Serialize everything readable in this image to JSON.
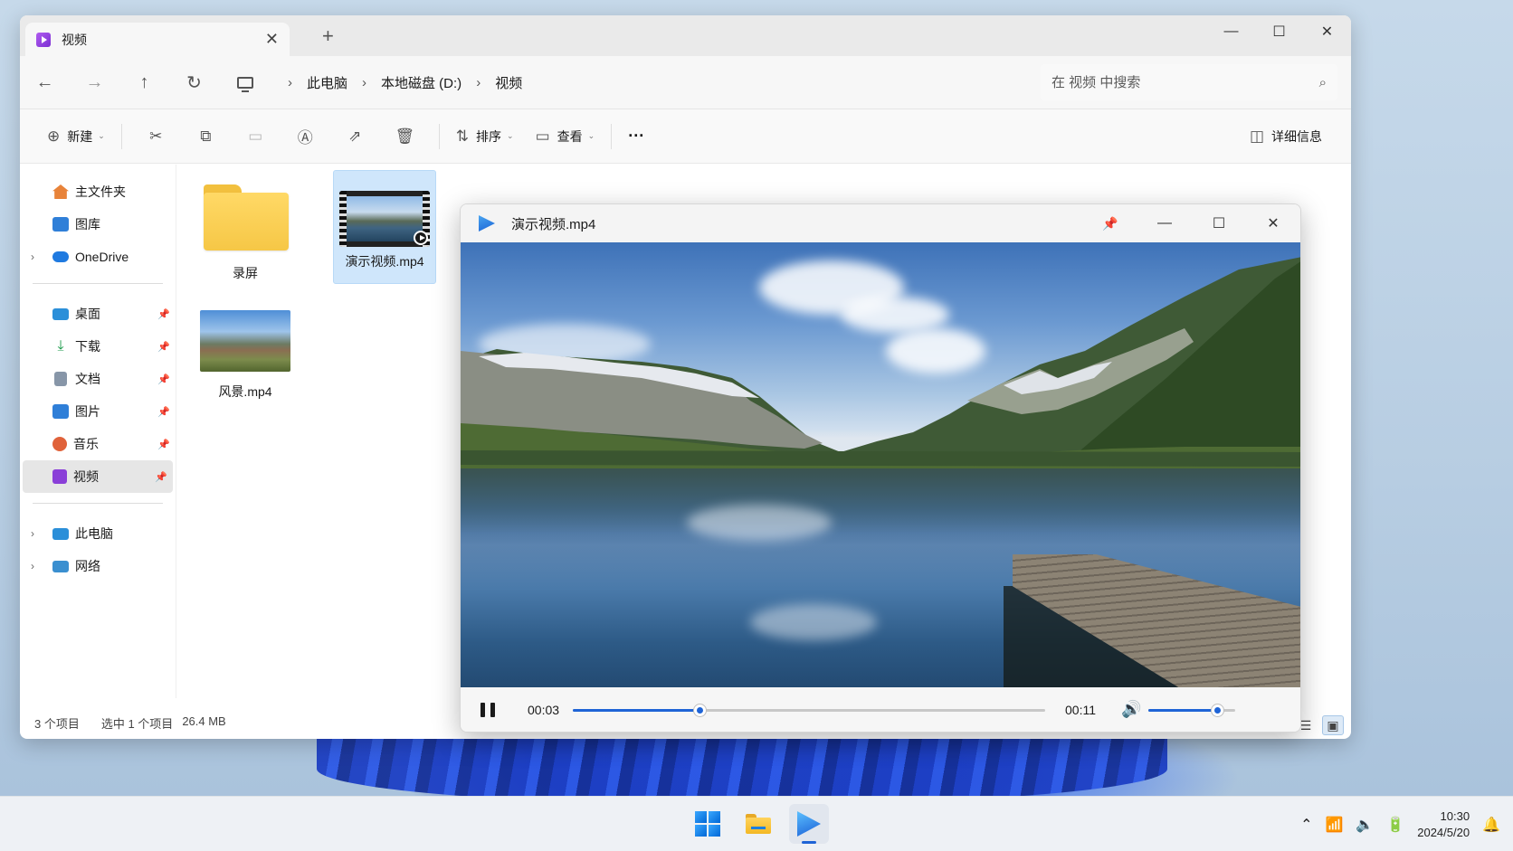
{
  "explorer": {
    "tab_title": "视频",
    "tab_close": "✕",
    "new_tab": "+",
    "window_controls": [
      "—",
      "☐",
      "✕"
    ],
    "nav": {
      "back": "←",
      "forward": "→",
      "up": "↑",
      "refresh": "↻"
    },
    "breadcrumb": [
      "此电脑",
      "本地磁盘 (D:)",
      "视频"
    ],
    "breadcrumb_sep": "›",
    "search_placeholder": "在 视频 中搜索",
    "commands": {
      "new_label": "新建",
      "sort_label": "排序",
      "view_label": "查看",
      "more": "···",
      "details_label": "详细信息"
    },
    "sidebar": {
      "top": [
        {
          "label": "主文件夹",
          "icon": "home-icon",
          "color": "#e8833a"
        },
        {
          "label": "图库",
          "icon": "gallery-icon",
          "color": "#2f7fd8"
        },
        {
          "label": "OneDrive",
          "icon": "cloud-icon",
          "color": "#1f7ae0"
        }
      ],
      "quick": [
        {
          "label": "桌面",
          "icon": "desktop-icon",
          "color": "#2b8fd9"
        },
        {
          "label": "下载",
          "icon": "download-icon",
          "color": "#1a9a4a"
        },
        {
          "label": "文档",
          "icon": "document-icon",
          "color": "#8796a8"
        },
        {
          "label": "图片",
          "icon": "pictures-icon",
          "color": "#2f7fd8"
        },
        {
          "label": "音乐",
          "icon": "music-icon",
          "color": "#e0623a"
        },
        {
          "label": "视频",
          "icon": "video-icon",
          "color": "#8a3fd8"
        }
      ],
      "bottom": [
        {
          "label": "此电脑",
          "icon": "pc-icon",
          "color": "#2b8fd9"
        },
        {
          "label": "网络",
          "icon": "network-icon",
          "color": "#3a8fd0"
        }
      ]
    },
    "files": [
      {
        "name": "录屏",
        "type": "folder"
      },
      {
        "name": "演示视频.mp4",
        "type": "video",
        "selected": true
      },
      {
        "name": "风景.mp4",
        "type": "video"
      }
    ],
    "status": {
      "count": "3 个项目",
      "selected": "选中 1 个项目",
      "size": "26.4 MB"
    }
  },
  "player": {
    "title": "演示视频.mp4",
    "controls": [
      "📌",
      "—",
      "☐",
      "✕"
    ],
    "current_time": "00:03",
    "duration": "00:11",
    "progress": 0.27,
    "volume": 0.8,
    "accent": "#1f64d6"
  },
  "taskbar": {
    "time": "10:30",
    "date": "2024/5/20",
    "tray_icons": [
      "chevron-up-icon",
      "wifi-icon",
      "speaker-icon",
      "battery-icon",
      "bell-icon"
    ]
  }
}
